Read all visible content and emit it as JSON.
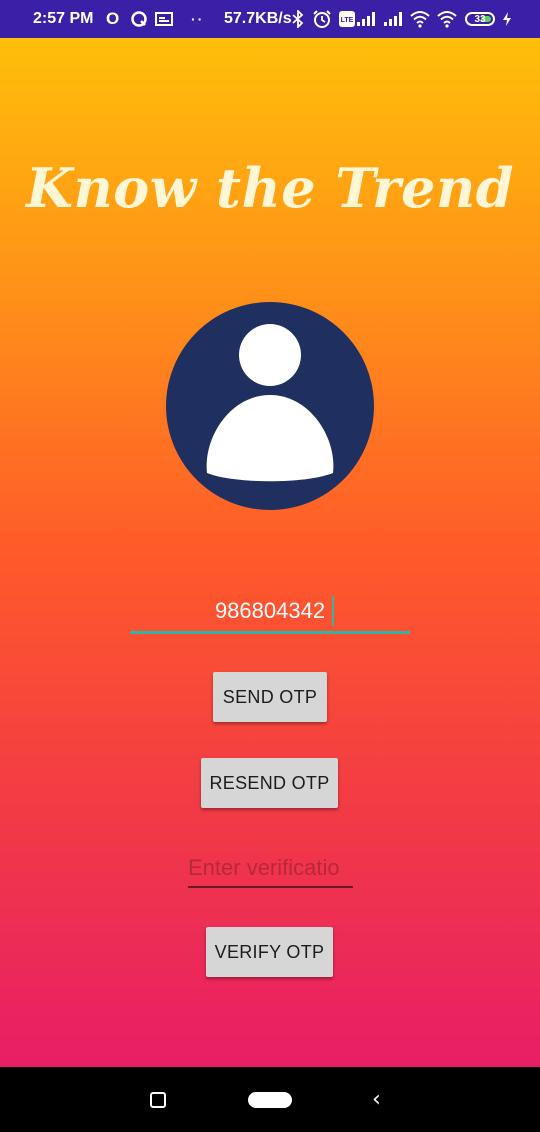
{
  "status_bar": {
    "time": "2:57 PM",
    "network_speed": "57.7KB/s",
    "battery_level": "33",
    "icons": [
      "opera-icon",
      "q-app-icon",
      "card-icon",
      "more-notifications-icon",
      "bluetooth-icon",
      "alarm-icon",
      "volte-icon",
      "signal-icon",
      "signal-icon",
      "wifi-icon",
      "wifi-icon",
      "battery-icon",
      "charging-icon"
    ]
  },
  "app": {
    "title": "Know the Trend",
    "avatar_icon": "user-avatar-icon",
    "phone_value": "986804342",
    "send_otp_label": "SEND OTP",
    "resend_otp_label": "RESEND OTP",
    "verification_placeholder": "Enter verificatio",
    "verify_otp_label": "VERIFY OTP"
  },
  "nav_bar": {
    "icons": [
      "recents-icon",
      "home-icon",
      "back-icon"
    ]
  },
  "colors": {
    "status_bar": "#3b1fa6",
    "gradient_top": "#ffbf0a",
    "gradient_bottom": "#e81e66",
    "avatar_bg": "#1f3060",
    "input_accent": "#34b3a0",
    "button_bg": "#d6d6d6"
  }
}
